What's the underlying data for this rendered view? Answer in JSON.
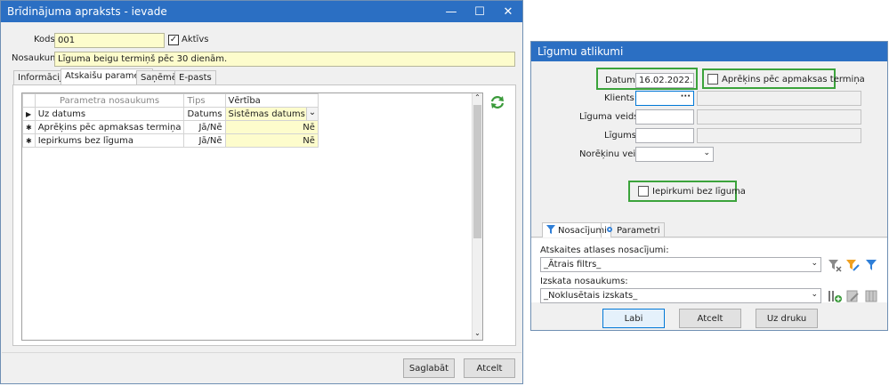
{
  "left_window": {
    "title": "Brīdinājuma apraksts - ievade",
    "controls": {
      "minimize": "—",
      "maximize": "☐",
      "close": "✕"
    },
    "kods_label": "Kods",
    "kods_value": "001",
    "aktivs_label": "Aktīvs",
    "aktivs_checked": "✓",
    "nosaukums_label": "Nosaukums",
    "nosaukums_value": "Līguma beigu termiņš pēc 30 dienām.",
    "tabs": [
      "Informācija",
      "Atskaišu parametri",
      "Saņēmēji",
      "E-pasts"
    ],
    "grid": {
      "headers": [
        "Parametra nosaukums",
        "Tips",
        "Vērtība"
      ],
      "rows": [
        {
          "marker": "▶",
          "name": "Uz datums",
          "type": "Datums",
          "value": "Sistēmas datums",
          "dropdown": "⌄"
        },
        {
          "marker": "✱",
          "name": "Aprēķins pēc apmaksas termiņa",
          "type": "Jā/Nē",
          "value": "Nē"
        },
        {
          "marker": "✱",
          "name": "Iepirkums bez līguma",
          "type": "Jā/Nē",
          "value": "Nē"
        }
      ],
      "refresh_icon": "refresh-icon",
      "scroll_up": "⌃",
      "scroll_down": "⌄"
    },
    "save_button": "Saglabāt",
    "cancel_button": "Atcelt"
  },
  "right_window": {
    "title": "Līgumu atlikumi",
    "datums_label": "Datums:",
    "datums_value": "16.02.2022.",
    "aprekins_label": "Aprēķins pēc apmaksas termiņa",
    "klients_label": "Klients:",
    "klients_lookup": "···",
    "liguma_veids_label": "Līguma veids:",
    "ligums_label": "Līgums:",
    "noreklinu_veids_label": "Norēķinu veids:",
    "iepirkumi_label": "Iepirkumi bez līguma",
    "tabs": [
      "Nosacījumi",
      "Parametri"
    ],
    "atlases_label": "Atskaites atlases nosacījumi:",
    "atlases_value": "_Ātrais filtrs_",
    "izskata_label": "Izskata nosaukums:",
    "izskata_value": "_Noklusētais izskats_",
    "ok_button": "Labi",
    "cancel_button": "Atcelt",
    "print_button": "Uz druku",
    "colors": {
      "highlight_border": "#3ba33b",
      "titlebar": "#2b6fc3",
      "required_field": "#fdfccc"
    }
  }
}
